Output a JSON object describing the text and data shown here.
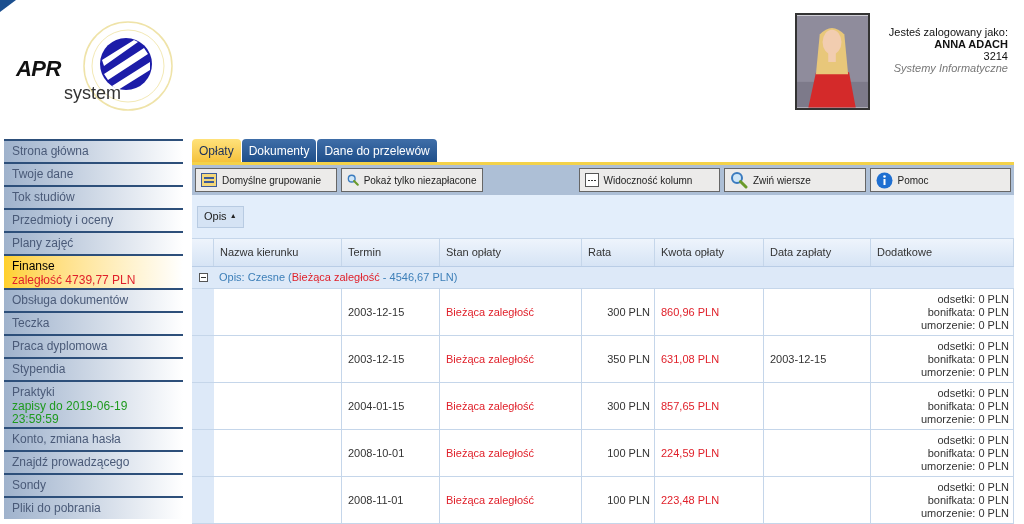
{
  "header": {
    "logo": {
      "mark": "APR",
      "word": "system"
    },
    "user": {
      "caption": "Jesteś zalogowany jako:",
      "name": "ANNA ADACH",
      "id": "3214",
      "unit": "Systemy Informatyczne"
    }
  },
  "sidebar": {
    "items": [
      {
        "label": "Strona główna",
        "selected": false
      },
      {
        "label": "Twoje dane",
        "selected": false
      },
      {
        "label": "Tok studiów",
        "selected": false
      },
      {
        "label": "Przedmioty i oceny",
        "selected": false
      },
      {
        "label": "Plany zajęć",
        "selected": false
      },
      {
        "label": "Finanse",
        "selected": true,
        "note": {
          "text": "zaległość 4739,77 PLN",
          "kind": "alert"
        }
      },
      {
        "label": "Obsługa dokumentów",
        "selected": false
      },
      {
        "label": "Teczka",
        "selected": false
      },
      {
        "label": "Praca dyplomowa",
        "selected": false
      },
      {
        "label": "Stypendia",
        "selected": false
      },
      {
        "label": "Praktyki",
        "selected": false,
        "note": {
          "text": "zapisy do 2019-06-19 23:59:59",
          "kind": "info"
        }
      },
      {
        "label": "Konto, zmiana hasła",
        "selected": false
      },
      {
        "label": "Znajdź prowadzącego",
        "selected": false
      },
      {
        "label": "Sondy",
        "selected": false
      },
      {
        "label": "Pliki do pobrania",
        "selected": false
      }
    ]
  },
  "tabs": [
    {
      "label": "Opłaty",
      "selected": true
    },
    {
      "label": "Dokumenty",
      "selected": false
    },
    {
      "label": "Dane do przelewów",
      "selected": false
    }
  ],
  "toolbar": [
    {
      "label": "Domyślne grupowanie",
      "kind": "grid"
    },
    {
      "label": "Pokaż tylko niezapłacone",
      "kind": "search"
    },
    {
      "label": "Widoczność kolumn",
      "kind": "dots"
    },
    {
      "label": "Zwiń wiersze",
      "kind": "search"
    },
    {
      "label": "Pomoc",
      "kind": "info"
    }
  ],
  "grouping": {
    "label": "Opis",
    "arrow": "▲"
  },
  "table": {
    "columns": [
      "Nazwa kierunku",
      "Termin",
      "Stan opłaty",
      "Rata",
      "Kwota opłaty",
      "Data zapłaty",
      "Dodatkowe"
    ],
    "group": {
      "expanded": true,
      "label": "Opis: Czesne (",
      "status": "Bieżąca zaległość",
      "rest": " - 4546,67 PLN)"
    },
    "rows": [
      {
        "termin": "2003-12-15",
        "status": "Bieżąca zaległość",
        "rata": "300 PLN",
        "kwota": "860,96 PLN",
        "extras": [
          "odsetki: 0 PLN",
          "bonifkata: 0 PLN",
          "umorzenie: 0 PLN"
        ]
      },
      {
        "termin": "2003-12-15",
        "status": "Bieżąca zaległość",
        "rata": "350 PLN",
        "kwota": "631,08 PLN",
        "paid": "2003-12-15",
        "extras": [
          "odsetki: 0 PLN",
          "bonifkata: 0 PLN",
          "umorzenie: 0 PLN"
        ]
      },
      {
        "termin": "2004-01-15",
        "status": "Bieżąca zaległość",
        "rata": "300 PLN",
        "kwota": "857,65 PLN",
        "extras": [
          "odsetki: 0 PLN",
          "bonifkata: 0 PLN",
          "umorzenie: 0 PLN"
        ]
      },
      {
        "termin": "2008-10-01",
        "status": "Bieżąca zaległość",
        "rata": "100 PLN",
        "kwota": "224,59 PLN",
        "extras": [
          "odsetki: 0 PLN",
          "bonifkata: 0 PLN",
          "umorzenie: 0 PLN"
        ]
      },
      {
        "termin": "2008-11-01",
        "status": "Bieżąca zaległość",
        "rata": "100 PLN",
        "kwota": "223,48 PLN",
        "extras": [
          "odsetki: 0 PLN",
          "bonifkata: 0 PLN",
          "umorzenie: 0 PLN"
        ]
      }
    ]
  }
}
